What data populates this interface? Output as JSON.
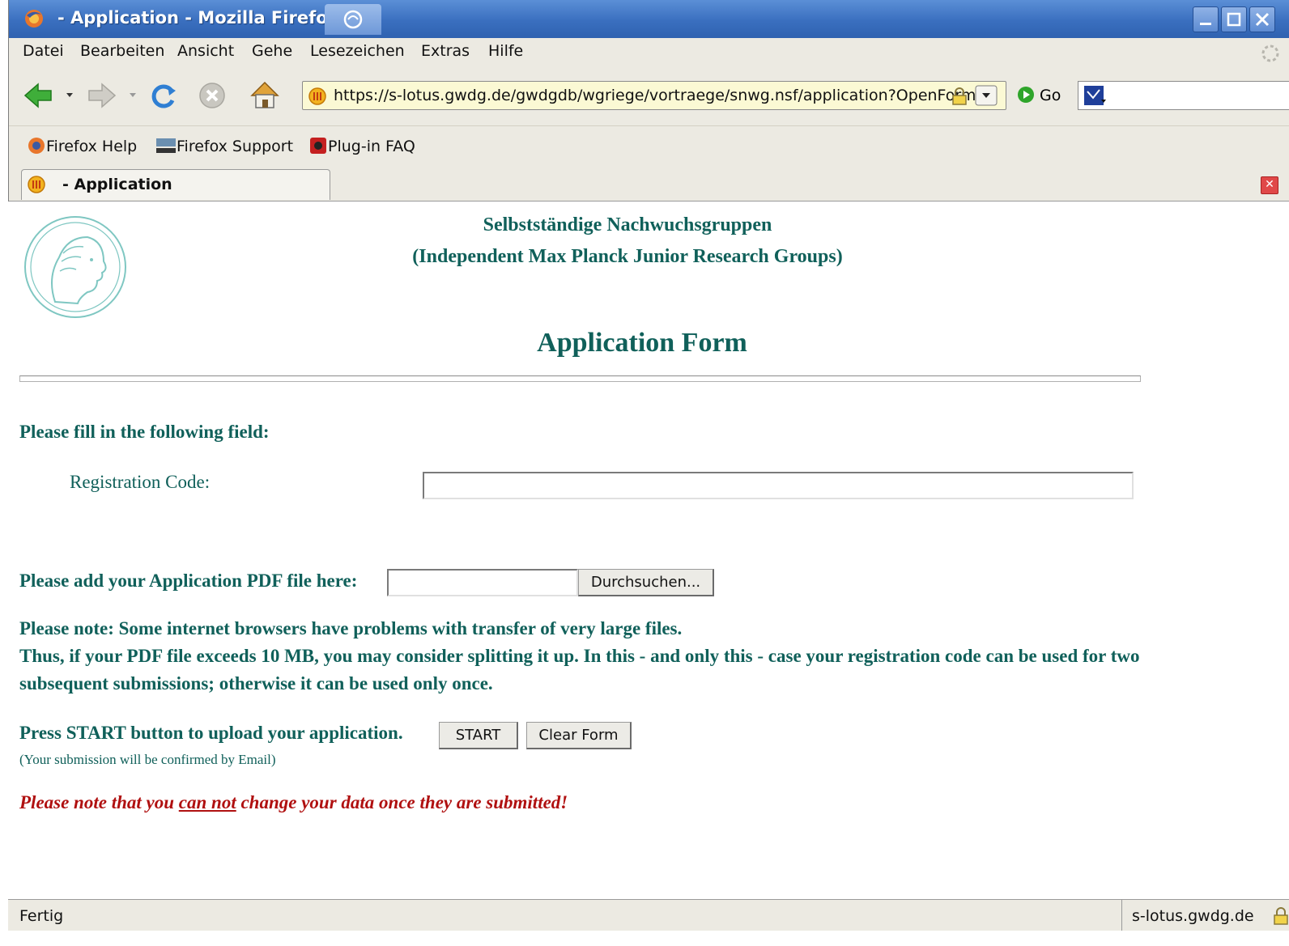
{
  "window": {
    "title": "- Application - Mozilla Firefox"
  },
  "menu": {
    "items": [
      "Datei",
      "Bearbeiten",
      "Ansicht",
      "Gehe",
      "Lesezeichen",
      "Extras",
      "Hilfe"
    ]
  },
  "nav": {
    "url": "https://s-lotus.gwdg.de/gwdgdb/wgriege/vortraege/snwg.nsf/application?OpenForm",
    "go_label": "Go"
  },
  "bookmarks": {
    "items": [
      "Firefox Help",
      "Firefox Support",
      "Plug-in FAQ"
    ]
  },
  "tab": {
    "label": "- Application"
  },
  "page": {
    "header_line1": "Selbstständige Nachwuchsgruppen",
    "header_line2": "(Independent Max Planck Junior Research Groups)",
    "form_title": "Application Form",
    "fill_prompt": "Please fill in the following field:",
    "registration_label": "Registration Code:",
    "registration_value": "",
    "pdf_prompt": "Please add your Application PDF file here:",
    "pdf_value": "",
    "browse_label": "Durchsuchen...",
    "note_line1": "Please note: Some internet browsers have problems with transfer of very large files.",
    "note_line2": "Thus, if your PDF file exceeds 10 MB, you may consider splitting it up. In this - and only this - case your registration code can be used for two",
    "note_line3": "subsequent submissions; otherwise it can be used only once.",
    "start_prompt": "Press START button to upload your application.",
    "start_label": "START",
    "clear_label": "Clear Form",
    "confirm_note": "(Your submission will be confirmed by Email)",
    "warning_pre": "Please note that you ",
    "warning_emph": "can not",
    "warning_post": " change your data once they are submitted!"
  },
  "status": {
    "text": "Fertig",
    "host": "s-lotus.gwdg.de"
  },
  "colors": {
    "title_bar": "#3a6fbf",
    "page_text": "#10605a",
    "warning": "#b01010",
    "url_background": "#fbf9d4"
  },
  "icons": [
    "firefox-icon",
    "back-arrow-icon",
    "forward-arrow-icon",
    "reload-icon",
    "stop-icon",
    "home-icon",
    "site-icon",
    "lock-icon",
    "dropdown-icon",
    "go-icon",
    "search-engine-icon",
    "throbber-icon",
    "tab-close-icon",
    "max-planck-logo"
  ]
}
